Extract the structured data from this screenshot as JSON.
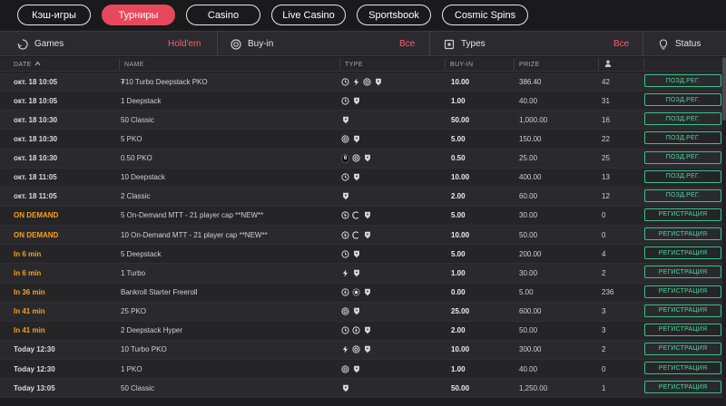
{
  "nav": {
    "tabs": [
      {
        "label": "Кэш-игры"
      },
      {
        "label": "Турниры"
      },
      {
        "label": "Casino"
      },
      {
        "label": "Live Casino"
      },
      {
        "label": "Sportsbook"
      },
      {
        "label": "Cosmic Spins"
      }
    ],
    "active_index": 1
  },
  "filters": {
    "games_label": "Games",
    "games_value": "Hold'em",
    "buyin_label": "Buy-in",
    "buyin_value": "Все",
    "types_label": "Types",
    "types_value": "Все",
    "status_label": "Status"
  },
  "columns": {
    "date": "DATE",
    "name": "NAME",
    "type": "TYPE",
    "buyin": "BUY-IN",
    "prize": "PRIZE",
    "players_icon": "person-icon"
  },
  "rows": [
    {
      "date": "окт. 18 10:05",
      "name": "₮10 Turbo Deepstack PKO",
      "icons": [
        "clock",
        "bolt",
        "target",
        "shield"
      ],
      "buyin": "10.00",
      "prize": "386.40",
      "players": "42",
      "status": "ПОЗД.РЕГ."
    },
    {
      "date": "окт. 18 10:05",
      "name": "1 Deepstack",
      "icons": [
        "clock",
        "shield"
      ],
      "buyin": "1.00",
      "prize": "40.00",
      "players": "31",
      "status": "ПОЗД.РЕГ."
    },
    {
      "date": "окт. 18 10:30",
      "name": "50 Classic",
      "icons": [
        "shield"
      ],
      "buyin": "50.00",
      "prize": "1,000.00",
      "players": "16",
      "status": "ПОЗД.РЕГ."
    },
    {
      "date": "окт. 18 10:30",
      "name": "5 PKO",
      "icons": [
        "target",
        "shield"
      ],
      "buyin": "5.00",
      "prize": "150.00",
      "players": "22",
      "status": "ПОЗД.РЕГ."
    },
    {
      "date": "окт. 18 10:30",
      "name": "0.50 PKO",
      "icons": [
        "six",
        "target",
        "shield"
      ],
      "buyin": "0.50",
      "prize": "25.00",
      "players": "25",
      "status": "ПОЗД.РЕГ."
    },
    {
      "date": "окт. 18 11:05",
      "name": "10 Deepstack",
      "icons": [
        "clock",
        "shield"
      ],
      "buyin": "10.00",
      "prize": "400.00",
      "players": "13",
      "status": "ПОЗД.РЕГ."
    },
    {
      "date": "окт. 18 11:05",
      "name": "2 Classic",
      "icons": [
        "shield"
      ],
      "buyin": "2.00",
      "prize": "60.00",
      "players": "12",
      "status": "ПОЗД.РЕГ."
    },
    {
      "date": "ON DEMAND",
      "on_demand": true,
      "name": "5 On-Demand MTT - 21 player cap **NEW**",
      "icons": [
        "flash",
        "crescent",
        "shield"
      ],
      "buyin": "5.00",
      "prize": "30.00",
      "players": "0",
      "status": "РЕГИСТРАЦИЯ"
    },
    {
      "date": "ON DEMAND",
      "on_demand": true,
      "name": "10 On-Demand MTT - 21 player cap **NEW**",
      "icons": [
        "flash",
        "crescent",
        "shield"
      ],
      "buyin": "10.00",
      "prize": "50.00",
      "players": "0",
      "status": "РЕГИСТРАЦИЯ"
    },
    {
      "date": "In 6 min",
      "on_demand": true,
      "name": "5 Deepstack",
      "icons": [
        "clock",
        "shield"
      ],
      "buyin": "5.00",
      "prize": "200.00",
      "players": "4",
      "status": "РЕГИСТРАЦИЯ"
    },
    {
      "date": "In 6 min",
      "on_demand": true,
      "name": "1 Turbo",
      "icons": [
        "bolt",
        "shield"
      ],
      "buyin": "1.00",
      "prize": "30.00",
      "players": "2",
      "status": "РЕГИСТРАЦИЯ"
    },
    {
      "date": "In 36 min",
      "on_demand": true,
      "name": "Bankroll Starter Freeroll",
      "icons": [
        "flash",
        "chip",
        "shield"
      ],
      "buyin": "0.00",
      "prize": "5.00",
      "players": "236",
      "status": "РЕГИСТРАЦИЯ"
    },
    {
      "date": "In 41 min",
      "on_demand": true,
      "name": "25 PKO",
      "icons": [
        "target",
        "shield"
      ],
      "buyin": "25.00",
      "prize": "600.00",
      "players": "3",
      "status": "РЕГИСТРАЦИЯ"
    },
    {
      "date": "In 41 min",
      "on_demand": true,
      "name": "2 Deepstack Hyper",
      "icons": [
        "clock",
        "flash",
        "shield"
      ],
      "buyin": "2.00",
      "prize": "50.00",
      "players": "3",
      "status": "РЕГИСТРАЦИЯ"
    },
    {
      "date": "Today 12:30",
      "name": "10 Turbo PKO",
      "icons": [
        "bolt",
        "target",
        "shield"
      ],
      "buyin": "10.00",
      "prize": "300.00",
      "players": "2",
      "status": "РЕГИСТРАЦИЯ"
    },
    {
      "date": "Today 12:30",
      "name": "1 PKO",
      "icons": [
        "target",
        "shield"
      ],
      "buyin": "1.00",
      "prize": "40.00",
      "players": "0",
      "status": "РЕГИСТРАЦИЯ"
    },
    {
      "date": "Today 13:05",
      "name": "50 Classic",
      "icons": [
        "shield"
      ],
      "buyin": "50.00",
      "prize": "1,250.00",
      "players": "1",
      "status": "РЕГИСТРАЦИЯ"
    }
  ],
  "colors": {
    "accent": "#e8485c",
    "status_green": "#3bc08a",
    "on_demand_orange": "#f6a01a"
  }
}
